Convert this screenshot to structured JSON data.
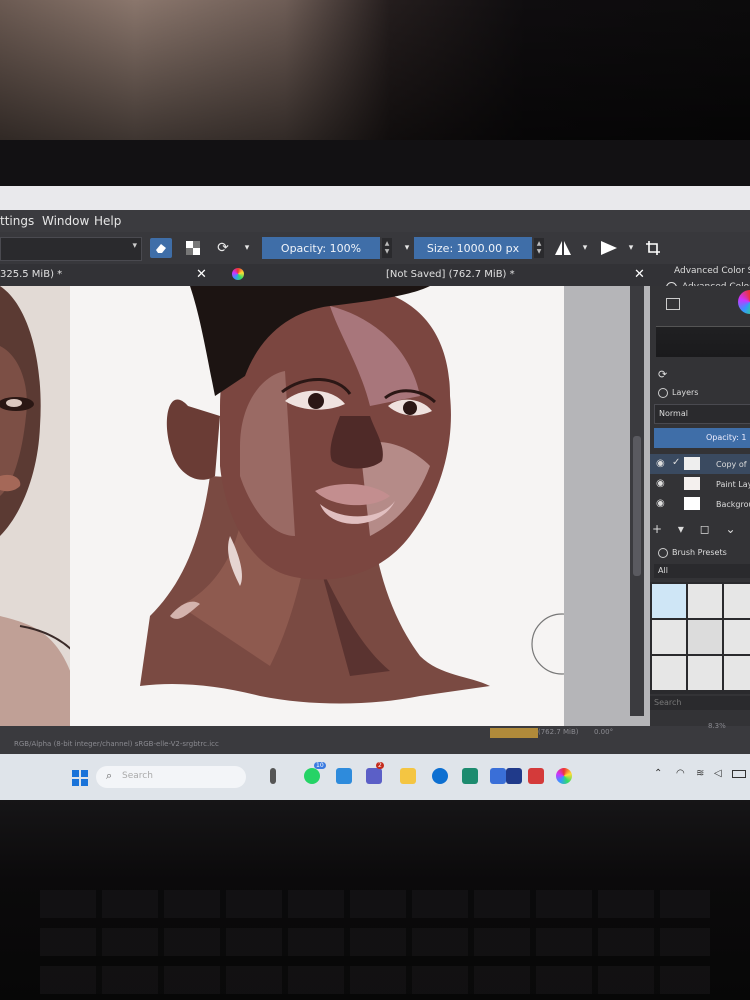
{
  "menu": {
    "items": [
      "ttings",
      "Window",
      "Help"
    ]
  },
  "toolbar": {
    "opacity_label": "Opacity: 100%",
    "size_label": "Size: 1000.00 px"
  },
  "tabs": {
    "left_tab": "325.5 MiB) *",
    "active_doc": "[Not Saved]  (762.7 MiB) *",
    "close_glyph": "✕"
  },
  "dockers": {
    "color_title": "Advanced Color S",
    "color_subtitle": "Advanced Color",
    "layers_title": "Layers",
    "blend_mode": "Normal",
    "opacity": "Opacity: 1",
    "layers": [
      "Copy of",
      "Paint Lay",
      "Backgrou"
    ],
    "layer_actions": "+ ▾ ◻ ⌄ ⌃",
    "presets_title": "Brush Presets",
    "presets_filter": "All",
    "search_placeholder": "Search"
  },
  "statusbar": {
    "color_space": "RGB/Alpha (8-bit integer/channel)  sRGB-elle-V2-srgbtrc.icc",
    "memory": "(762.7 MiB)",
    "rotation": "0.00°",
    "zoom": "8.3%"
  },
  "taskbar": {
    "search_label": "Search",
    "whatsapp_badge": "10",
    "teams_badge": "2"
  },
  "colors": {
    "accent": "#3f6ea8",
    "panel": "#333336",
    "skin_dark": "#6a3c35",
    "skin_mid": "#8a5548",
    "skin_light": "#c79f98"
  }
}
